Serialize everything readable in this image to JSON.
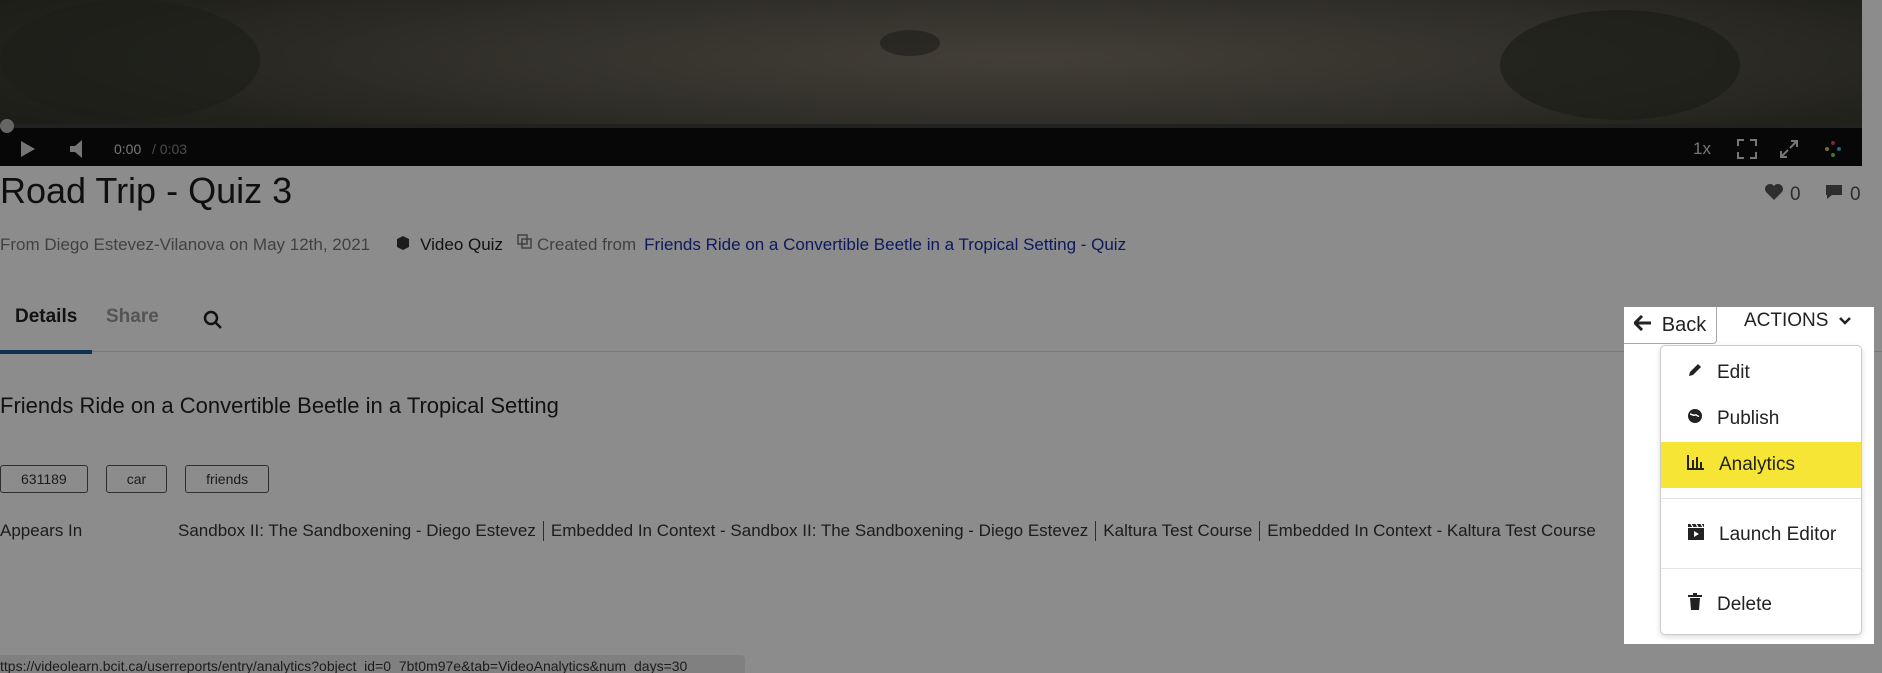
{
  "player": {
    "current_time": "0:00",
    "total_time": "/ 0:03",
    "speed": "1x"
  },
  "entry": {
    "title": "Road Trip - Quiz 3",
    "likes": "0",
    "comments": "0",
    "from_text": "From Diego Estevez-Vilanova on May 12th, 2021",
    "type": "Video Quiz",
    "created_from_label": "Created from",
    "created_from_link": "Friends Ride on a Convertible Beetle in a Tropical Setting - Quiz",
    "description_title": "Friends Ride on a Convertible Beetle in a Tropical Setting",
    "tags": [
      "631189",
      "car",
      "friends"
    ],
    "appears_in_label": "Appears In",
    "appears_in": [
      "Sandbox II: The Sandboxening - Diego Estevez",
      "Embedded In Context - Sandbox II: The Sandboxening - Diego Estevez",
      "Kaltura Test Course",
      "Embedded In Context - Kaltura Test Course"
    ]
  },
  "tabs": {
    "details": "Details",
    "share": "Share"
  },
  "buttons": {
    "back": "Back",
    "actions": "ACTIONS"
  },
  "menu": {
    "items": [
      {
        "label": "Edit",
        "icon": "pencil-icon"
      },
      {
        "label": "Publish",
        "icon": "globe-icon"
      },
      {
        "label": "Analytics",
        "icon": "bar-chart-icon",
        "highlighted": true
      },
      {
        "label": "Launch Editor",
        "icon": "clapperboard-icon"
      },
      {
        "label": "Delete",
        "icon": "trash-icon"
      }
    ],
    "highlight_color": "#f6e535"
  },
  "status_url": "ttps://videolearn.bcit.ca/userreports/entry/analytics?object_id=0_7bt0m97e&tab=VideoAnalytics&num_days=30"
}
